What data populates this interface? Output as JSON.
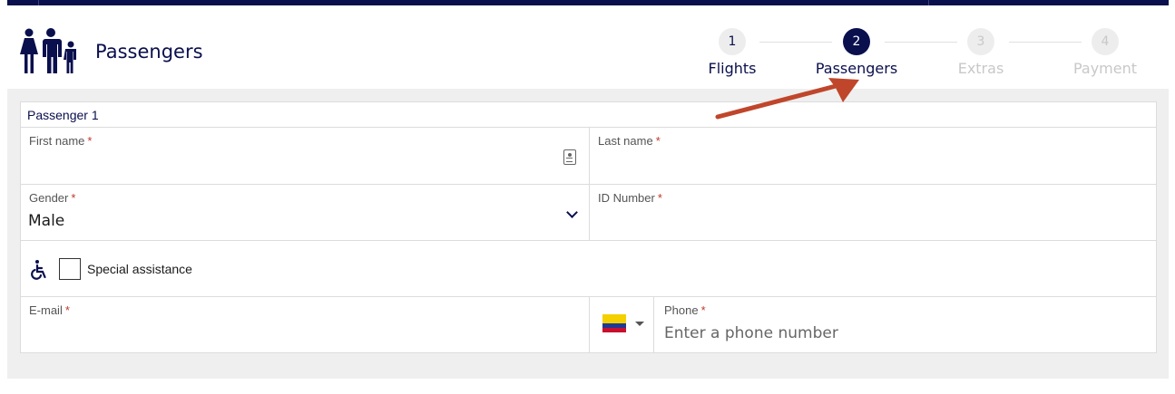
{
  "header": {
    "title": "Passengers",
    "icon": "family-icon"
  },
  "stepper": {
    "steps": [
      {
        "number": "1",
        "label": "Flights",
        "state": "done"
      },
      {
        "number": "2",
        "label": "Passengers",
        "state": "active"
      },
      {
        "number": "3",
        "label": "Extras",
        "state": "todo"
      },
      {
        "number": "4",
        "label": "Payment",
        "state": "todo"
      }
    ]
  },
  "form": {
    "passenger_title": "Passenger 1",
    "first_name": {
      "label": "First name",
      "required": "*",
      "value": ""
    },
    "last_name": {
      "label": "Last name",
      "required": "*",
      "value": ""
    },
    "gender": {
      "label": "Gender",
      "required": "*",
      "value": "Male"
    },
    "id_number": {
      "label": "ID Number",
      "required": "*",
      "value": ""
    },
    "special_assistance": {
      "label": "Special assistance",
      "checked": false,
      "icon": "wheelchair-icon"
    },
    "email": {
      "label": "E-mail",
      "required": "*",
      "value": ""
    },
    "phone": {
      "label": "Phone",
      "required": "*",
      "placeholder": "Enter a phone number",
      "country_flag": "colombia-flag-icon"
    }
  },
  "colors": {
    "brand_navy": "#0a0f4d",
    "required_red": "#c0392b",
    "annotation_arrow": "#c0462b",
    "form_background": "#efefef"
  }
}
